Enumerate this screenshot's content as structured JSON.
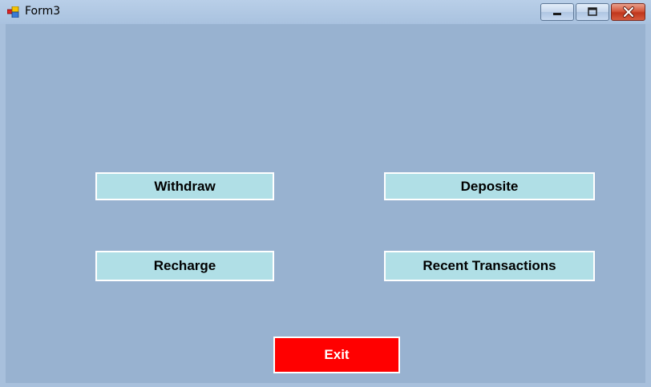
{
  "window": {
    "title": "Form3"
  },
  "buttons": {
    "withdraw": "Withdraw",
    "deposite": "Deposite",
    "recharge": "Recharge",
    "recent_transactions": "Recent Transactions",
    "exit": "Exit"
  },
  "colors": {
    "client_background": "#98b2d0",
    "button_background": "#b0dfe6",
    "exit_background": "#ff0000",
    "exit_text": "#ffffff"
  },
  "icons": {
    "app": "app-form-icon",
    "minimize": "minimize-icon",
    "maximize": "maximize-icon",
    "close": "close-icon"
  }
}
